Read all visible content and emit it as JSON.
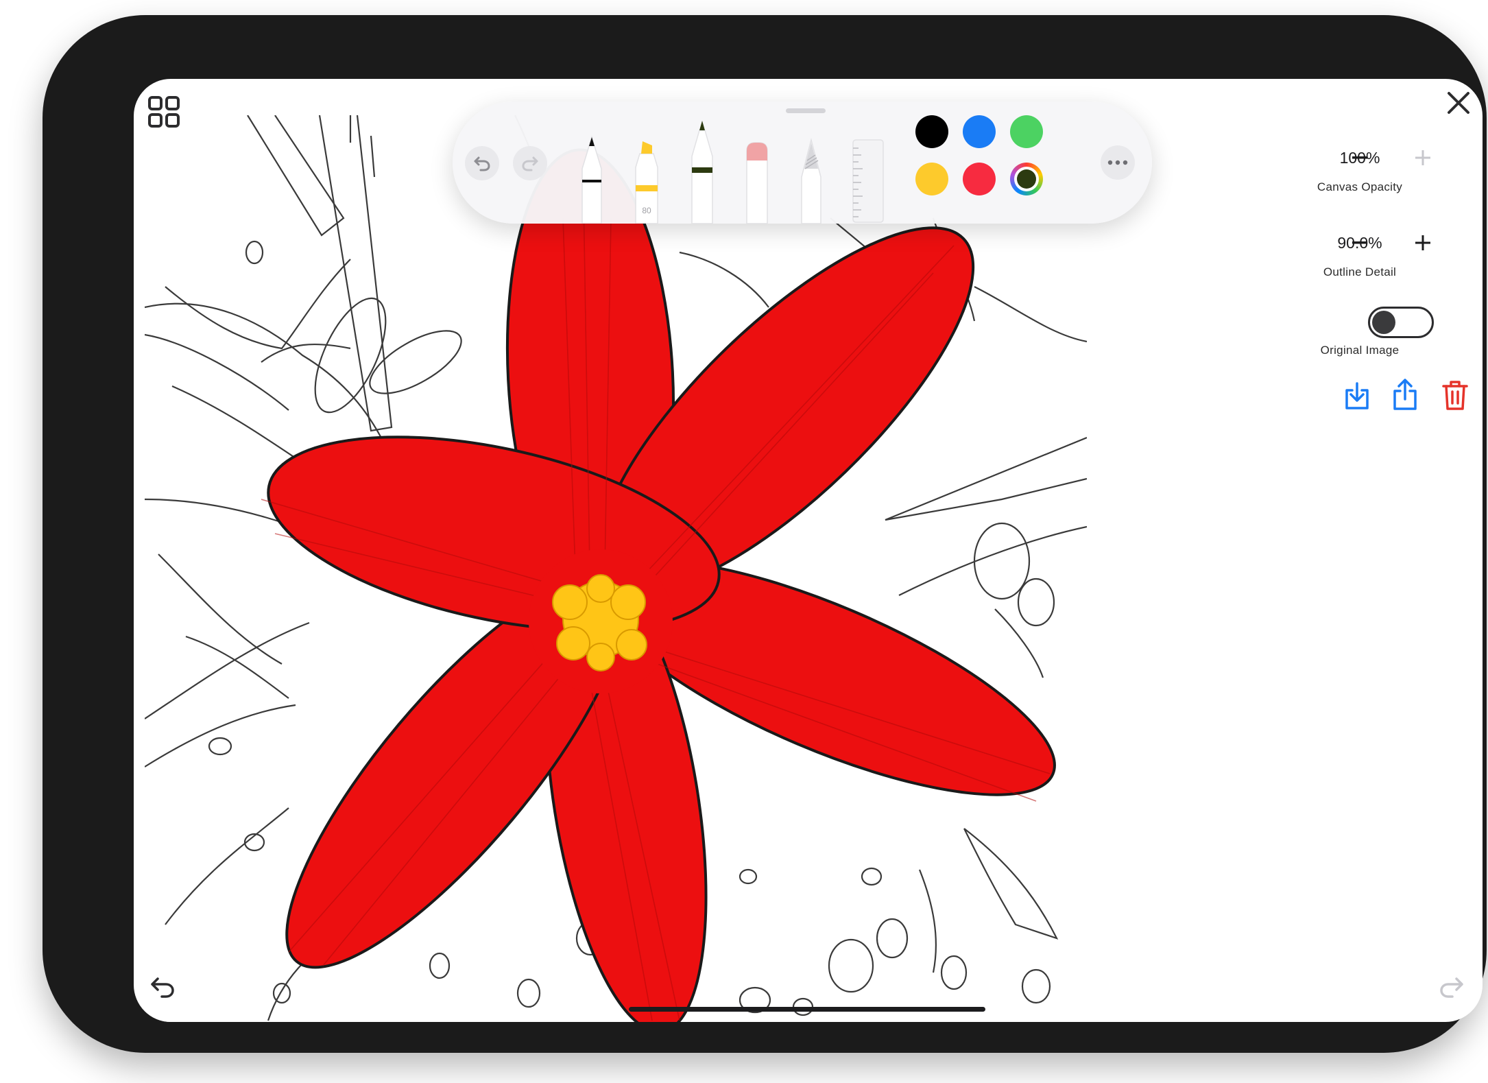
{
  "icons": {
    "gallery": "grid-icon",
    "close": "close-icon",
    "undo": "undo-icon",
    "redo": "redo-icon",
    "more": "ellipsis-icon",
    "download": "download-icon",
    "share": "share-icon",
    "delete": "trash-icon"
  },
  "toolbar": {
    "tools": [
      {
        "name": "pen",
        "active": false
      },
      {
        "name": "highlighter",
        "active": false,
        "label": "80"
      },
      {
        "name": "fineliner",
        "active": true
      },
      {
        "name": "eraser",
        "active": false
      },
      {
        "name": "pencil",
        "active": false
      },
      {
        "name": "ruler",
        "active": false
      }
    ],
    "colors": [
      "#000000",
      "#1a7cf5",
      "#4cd262",
      "#fdca2c",
      "#f72b40",
      "#2c3a10"
    ],
    "selected_color": "#2c3a10"
  },
  "panel": {
    "canvas_opacity": {
      "value": "100%",
      "label": "Canvas Opacity"
    },
    "outline_detail": {
      "value": "90.0%",
      "label": "Outline Detail"
    },
    "original_image": {
      "label": "Original Image",
      "on": false
    }
  },
  "colors": {
    "accent": "#1a7cf5",
    "danger": "#e5332a",
    "flower_red": "#ec0f10",
    "flower_center": "#ffc516"
  }
}
